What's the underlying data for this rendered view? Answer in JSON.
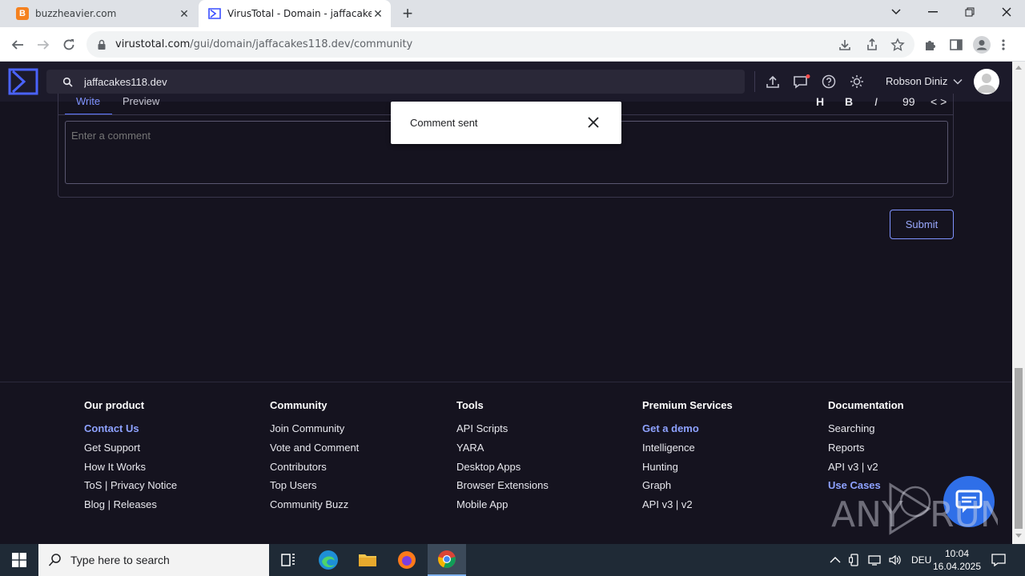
{
  "browser": {
    "tabs": [
      {
        "title": "buzzheavier.com",
        "favicon": "B",
        "favicon_color": "#f5811f"
      },
      {
        "title": "VirusTotal - Domain - jaffacakes1",
        "active": true
      }
    ],
    "url_host": "virustotal.com",
    "url_path": "/gui/domain/jaffacakes118.dev/community"
  },
  "vt_header": {
    "search_value": "jaffacakes118.dev",
    "user_name": "Robson Diniz"
  },
  "editor": {
    "tab_write": "Write",
    "tab_preview": "Preview",
    "format_buttons": [
      "H",
      "B",
      "I",
      "99",
      "< >"
    ],
    "comment_placeholder": "Enter a comment",
    "submit_label": "Submit"
  },
  "toast": {
    "message": "Comment sent"
  },
  "footer": {
    "columns": [
      {
        "heading": "Our product",
        "links": [
          {
            "label": "Contact Us",
            "highlight": true
          },
          {
            "label": "Get Support"
          },
          {
            "label": "How It Works"
          },
          {
            "label": "ToS | Privacy Notice"
          },
          {
            "label": "Blog | Releases"
          }
        ]
      },
      {
        "heading": "Community",
        "links": [
          {
            "label": "Join Community"
          },
          {
            "label": "Vote and Comment"
          },
          {
            "label": "Contributors"
          },
          {
            "label": "Top Users"
          },
          {
            "label": "Community Buzz"
          }
        ]
      },
      {
        "heading": "Tools",
        "links": [
          {
            "label": "API Scripts"
          },
          {
            "label": "YARA"
          },
          {
            "label": "Desktop Apps"
          },
          {
            "label": "Browser Extensions"
          },
          {
            "label": "Mobile App"
          }
        ]
      },
      {
        "heading": "Premium Services",
        "links": [
          {
            "label": "Get a demo",
            "highlight": true
          },
          {
            "label": "Intelligence"
          },
          {
            "label": "Hunting"
          },
          {
            "label": "Graph"
          },
          {
            "label": "API v3 | v2"
          }
        ]
      },
      {
        "heading": "Documentation",
        "links": [
          {
            "label": "Searching"
          },
          {
            "label": "Reports"
          },
          {
            "label": "API v3 | v2"
          },
          {
            "label": "Use Cases",
            "highlight": true
          }
        ]
      }
    ]
  },
  "watermark": "ANY RUN",
  "taskbar": {
    "search_placeholder": "Type here to search",
    "language": "DEU",
    "time": "10:04",
    "date": "16.04.2025"
  },
  "colors": {
    "page_bg": "#15131f",
    "header_bg": "#1c1a2a",
    "accent": "#7f93ff",
    "toast_bg": "#ffffff"
  }
}
